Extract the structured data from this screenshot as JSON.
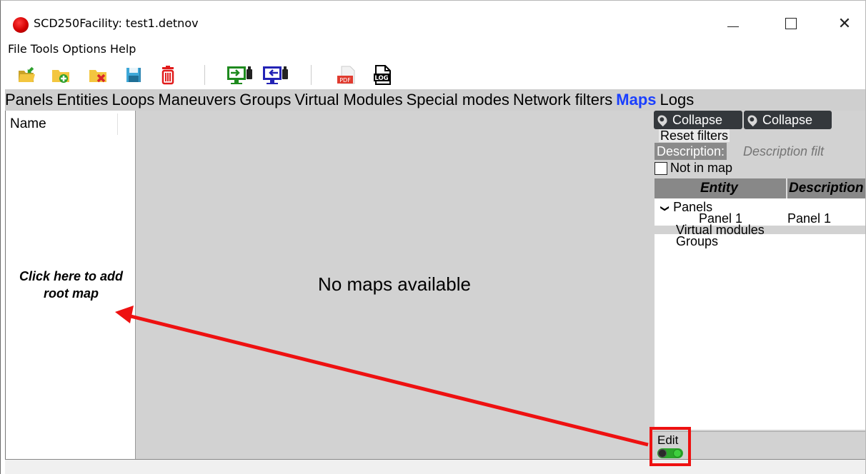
{
  "window": {
    "title": "SCD250Facility: test1.detnov",
    "icon": "red-circle-icon",
    "controls": {
      "minimize": "—",
      "maximize": "□",
      "close": "✕"
    }
  },
  "menubar": {
    "items": [
      "File",
      "Tools",
      "Options",
      "Help"
    ]
  },
  "toolbar": {
    "buttons": [
      {
        "name": "open-folder-icon"
      },
      {
        "name": "new-folder-icon"
      },
      {
        "name": "delete-folder-icon"
      },
      {
        "name": "save-icon"
      },
      {
        "name": "trash-icon"
      },
      {
        "name": "upload-to-device-icon"
      },
      {
        "name": "download-from-device-icon"
      },
      {
        "name": "pdf-icon",
        "label": "PDF"
      },
      {
        "name": "log-icon",
        "label": "LOG"
      }
    ]
  },
  "tabs": {
    "items": [
      "Panels",
      "Entities",
      "Loops",
      "Maneuvers",
      "Groups",
      "Virtual Modules",
      "Special modes",
      "Network filters",
      "Maps",
      "Logs"
    ],
    "active": "Maps"
  },
  "left_panel": {
    "header": "Name",
    "add_root_line1": "Click here to add",
    "add_root_line2": "root map"
  },
  "canvas": {
    "empty_message": "No maps available"
  },
  "right_panel": {
    "collapse_1": "Collapse",
    "collapse_2": "Collapse",
    "reset_filters": "Reset filters",
    "description_label": "Description:",
    "description_placeholder": "Description filt",
    "not_in_map": "Not in map",
    "table": {
      "columns": [
        "Entity",
        "Description"
      ],
      "rows": [
        {
          "entity": "Panels",
          "description": "",
          "expanded": true
        },
        {
          "entity": "Panel 1",
          "description": "Panel 1"
        },
        {
          "entity": "Virtual modules",
          "description": ""
        },
        {
          "entity": "Groups",
          "description": ""
        }
      ]
    },
    "edit_label": "Edit"
  },
  "colors": {
    "active_tab": "#1a3fff",
    "annotation": "#ee1111",
    "toggle_on": "#2ba52b",
    "canvas_bg": "#d2d2d2",
    "collapse_bg": "#34383c"
  }
}
